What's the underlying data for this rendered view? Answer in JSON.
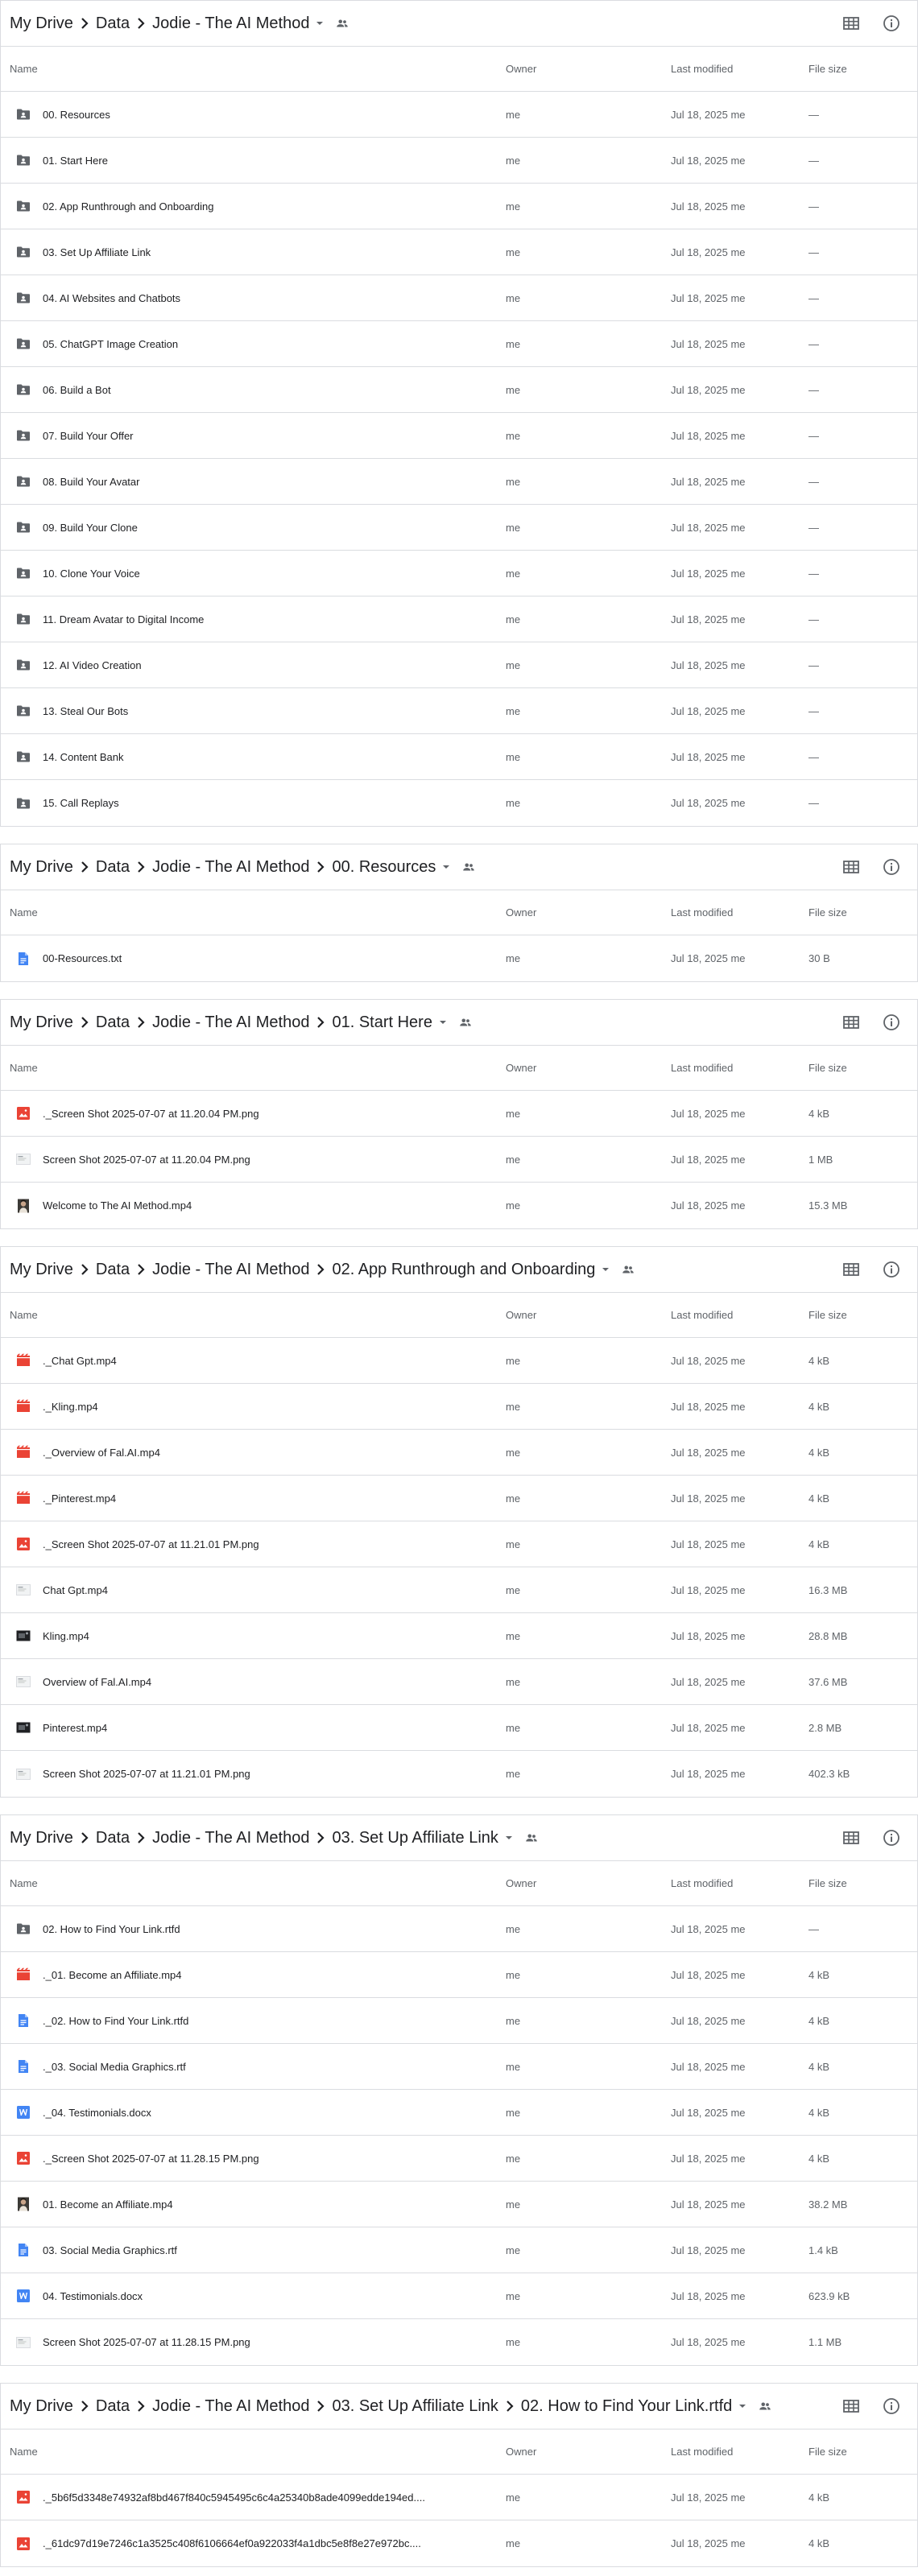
{
  "columns": {
    "name": "Name",
    "owner": "Owner",
    "modified": "Last modified",
    "size": "File size"
  },
  "panels": [
    {
      "crumbs": [
        "My Drive",
        "Data",
        "Jodie - The AI Method"
      ],
      "rows": [
        {
          "icon": "shared-folder-icon",
          "name": "00. Resources",
          "owner": "me",
          "modified": "Jul 18, 2025 me",
          "size": "—"
        },
        {
          "icon": "shared-folder-icon",
          "name": "01. Start Here",
          "owner": "me",
          "modified": "Jul 18, 2025 me",
          "size": "—"
        },
        {
          "icon": "shared-folder-icon",
          "name": "02. App Runthrough and Onboarding",
          "owner": "me",
          "modified": "Jul 18, 2025 me",
          "size": "—"
        },
        {
          "icon": "shared-folder-icon",
          "name": "03. Set Up Affiliate Link",
          "owner": "me",
          "modified": "Jul 18, 2025 me",
          "size": "—"
        },
        {
          "icon": "shared-folder-icon",
          "name": "04. AI Websites and Chatbots",
          "owner": "me",
          "modified": "Jul 18, 2025 me",
          "size": "—"
        },
        {
          "icon": "shared-folder-icon",
          "name": "05. ChatGPT Image Creation",
          "owner": "me",
          "modified": "Jul 18, 2025 me",
          "size": "—"
        },
        {
          "icon": "shared-folder-icon",
          "name": "06. Build a Bot",
          "owner": "me",
          "modified": "Jul 18, 2025 me",
          "size": "—"
        },
        {
          "icon": "shared-folder-icon",
          "name": "07. Build Your Offer",
          "owner": "me",
          "modified": "Jul 18, 2025 me",
          "size": "—"
        },
        {
          "icon": "shared-folder-icon",
          "name": "08. Build Your Avatar",
          "owner": "me",
          "modified": "Jul 18, 2025 me",
          "size": "—"
        },
        {
          "icon": "shared-folder-icon",
          "name": "09. Build Your Clone",
          "owner": "me",
          "modified": "Jul 18, 2025 me",
          "size": "—"
        },
        {
          "icon": "shared-folder-icon",
          "name": "10. Clone Your Voice",
          "owner": "me",
          "modified": "Jul 18, 2025 me",
          "size": "—"
        },
        {
          "icon": "shared-folder-icon",
          "name": "11. Dream Avatar to Digital Income",
          "owner": "me",
          "modified": "Jul 18, 2025 me",
          "size": "—"
        },
        {
          "icon": "shared-folder-icon",
          "name": "12. AI Video Creation",
          "owner": "me",
          "modified": "Jul 18, 2025 me",
          "size": "—"
        },
        {
          "icon": "shared-folder-icon",
          "name": "13. Steal Our Bots",
          "owner": "me",
          "modified": "Jul 18, 2025 me",
          "size": "—"
        },
        {
          "icon": "shared-folder-icon",
          "name": "14. Content Bank",
          "owner": "me",
          "modified": "Jul 18, 2025 me",
          "size": "—"
        },
        {
          "icon": "shared-folder-icon",
          "name": "15. Call Replays",
          "owner": "me",
          "modified": "Jul 18, 2025 me",
          "size": "—"
        }
      ]
    },
    {
      "crumbs": [
        "My Drive",
        "Data",
        "Jodie - The AI Method",
        "00. Resources"
      ],
      "rows": [
        {
          "icon": "doc-icon",
          "name": "00-Resources.txt",
          "owner": "me",
          "modified": "Jul 18, 2025 me",
          "size": "30 B"
        }
      ]
    },
    {
      "crumbs": [
        "My Drive",
        "Data",
        "Jodie - The AI Method",
        "01. Start Here"
      ],
      "rows": [
        {
          "icon": "image-icon",
          "name": "._Screen Shot 2025-07-07 at 11.20.04 PM.png",
          "owner": "me",
          "modified": "Jul 18, 2025 me",
          "size": "4 kB"
        },
        {
          "icon": "thumb-light-icon",
          "name": "Screen Shot 2025-07-07 at 11.20.04 PM.png",
          "owner": "me",
          "modified": "Jul 18, 2025 me",
          "size": "1 MB"
        },
        {
          "icon": "thumb-photo-icon",
          "name": "Welcome to The AI Method.mp4",
          "owner": "me",
          "modified": "Jul 18, 2025 me",
          "size": "15.3 MB"
        }
      ]
    },
    {
      "crumbs": [
        "My Drive",
        "Data",
        "Jodie - The AI Method",
        "02. App Runthrough and Onboarding"
      ],
      "rows": [
        {
          "icon": "video-icon",
          "name": "._Chat Gpt.mp4",
          "owner": "me",
          "modified": "Jul 18, 2025 me",
          "size": "4 kB"
        },
        {
          "icon": "video-icon",
          "name": "._Kling.mp4",
          "owner": "me",
          "modified": "Jul 18, 2025 me",
          "size": "4 kB"
        },
        {
          "icon": "video-icon",
          "name": "._Overview of Fal.AI.mp4",
          "owner": "me",
          "modified": "Jul 18, 2025 me",
          "size": "4 kB"
        },
        {
          "icon": "video-icon",
          "name": "._Pinterest.mp4",
          "owner": "me",
          "modified": "Jul 18, 2025 me",
          "size": "4 kB"
        },
        {
          "icon": "image-icon",
          "name": "._Screen Shot 2025-07-07 at 11.21.01 PM.png",
          "owner": "me",
          "modified": "Jul 18, 2025 me",
          "size": "4 kB"
        },
        {
          "icon": "thumb-light-icon",
          "name": "Chat Gpt.mp4",
          "owner": "me",
          "modified": "Jul 18, 2025 me",
          "size": "16.3 MB"
        },
        {
          "icon": "thumb-dark-icon",
          "name": "Kling.mp4",
          "owner": "me",
          "modified": "Jul 18, 2025 me",
          "size": "28.8 MB"
        },
        {
          "icon": "thumb-light-icon",
          "name": "Overview of Fal.AI.mp4",
          "owner": "me",
          "modified": "Jul 18, 2025 me",
          "size": "37.6 MB"
        },
        {
          "icon": "thumb-dark-icon",
          "name": "Pinterest.mp4",
          "owner": "me",
          "modified": "Jul 18, 2025 me",
          "size": "2.8 MB"
        },
        {
          "icon": "thumb-light-icon",
          "name": "Screen Shot 2025-07-07 at 11.21.01 PM.png",
          "owner": "me",
          "modified": "Jul 18, 2025 me",
          "size": "402.3 kB"
        }
      ]
    },
    {
      "crumbs": [
        "My Drive",
        "Data",
        "Jodie - The AI Method",
        "03. Set Up Affiliate Link"
      ],
      "rows": [
        {
          "icon": "shared-folder-icon",
          "name": "02. How to Find Your Link.rtfd",
          "owner": "me",
          "modified": "Jul 18, 2025 me",
          "size": "—"
        },
        {
          "icon": "video-icon",
          "name": "._01. Become an Affiliate.mp4",
          "owner": "me",
          "modified": "Jul 18, 2025 me",
          "size": "4 kB"
        },
        {
          "icon": "doc-icon",
          "name": "._02. How to Find Your Link.rtfd",
          "owner": "me",
          "modified": "Jul 18, 2025 me",
          "size": "4 kB"
        },
        {
          "icon": "doc-icon",
          "name": "._03. Social Media Graphics.rtf",
          "owner": "me",
          "modified": "Jul 18, 2025 me",
          "size": "4 kB"
        },
        {
          "icon": "word-icon",
          "name": "._04. Testimonials.docx",
          "owner": "me",
          "modified": "Jul 18, 2025 me",
          "size": "4 kB"
        },
        {
          "icon": "image-icon",
          "name": "._Screen Shot 2025-07-07 at 11.28.15 PM.png",
          "owner": "me",
          "modified": "Jul 18, 2025 me",
          "size": "4 kB"
        },
        {
          "icon": "thumb-photo-icon",
          "name": "01. Become an Affiliate.mp4",
          "owner": "me",
          "modified": "Jul 18, 2025 me",
          "size": "38.2 MB"
        },
        {
          "icon": "doc-icon",
          "name": "03. Social Media Graphics.rtf",
          "owner": "me",
          "modified": "Jul 18, 2025 me",
          "size": "1.4 kB"
        },
        {
          "icon": "word-icon",
          "name": "04. Testimonials.docx",
          "owner": "me",
          "modified": "Jul 18, 2025 me",
          "size": "623.9 kB"
        },
        {
          "icon": "thumb-light-icon",
          "name": "Screen Shot 2025-07-07 at 11.28.15 PM.png",
          "owner": "me",
          "modified": "Jul 18, 2025 me",
          "size": "1.1 MB"
        }
      ]
    },
    {
      "crumbs": [
        "My Drive",
        "Data",
        "Jodie - The AI Method",
        "03. Set Up Affiliate Link",
        "02. How to Find Your Link.rtfd"
      ],
      "rows": [
        {
          "icon": "image-icon",
          "name": "._5b6f5d3348e74932af8bd467f840c5945495c6c4a25340b8ade4099edde194ed....",
          "owner": "me",
          "modified": "Jul 18, 2025 me",
          "size": "4 kB"
        },
        {
          "icon": "image-icon",
          "name": "._61dc97d19e7246c1a3525c408f6106664ef0a922033f4a1dbc5e8f8e27e972bc....",
          "owner": "me",
          "modified": "Jul 18, 2025 me",
          "size": "4 kB"
        }
      ]
    }
  ]
}
